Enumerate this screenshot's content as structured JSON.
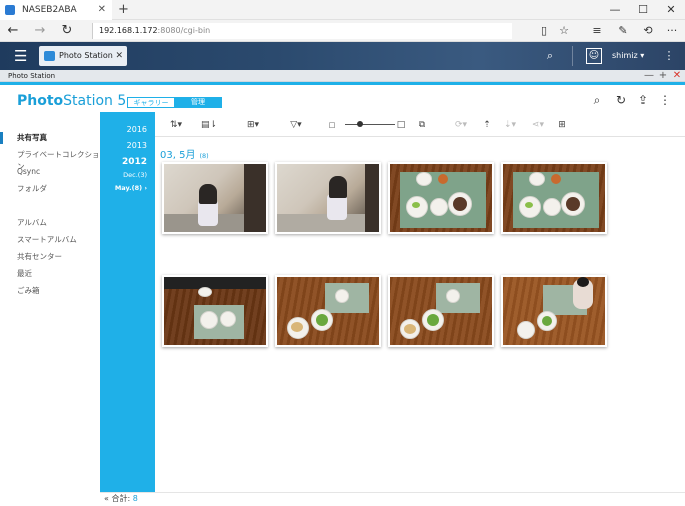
{
  "browser": {
    "tab_title": "NASEB2ABA",
    "new_tab": "+",
    "url_host": "192.168.1.172",
    "url_path": ":8080/cgi-bin",
    "window_controls": [
      "—",
      "☐",
      "✕"
    ]
  },
  "qnap": {
    "app_tab_label": "Photo Station",
    "user": "shimiz ▾"
  },
  "window": {
    "title": "Photo Station",
    "controls": [
      "—",
      "+",
      "✕"
    ]
  },
  "header": {
    "logo_bold": "Photo",
    "logo_rest": "Station 5",
    "mode_gallery": "ギャラリー",
    "mode_manage": "管理"
  },
  "sidebar": {
    "items": [
      {
        "label": "共有写真",
        "active": true
      },
      {
        "label": "プライベートコレクション"
      },
      {
        "label": "Qsync"
      },
      {
        "label": "フォルダ"
      },
      {
        "label": "アルバム"
      },
      {
        "label": "スマートアルバム"
      },
      {
        "label": "共有センター"
      },
      {
        "label": "最近"
      },
      {
        "label": "ごみ箱"
      }
    ]
  },
  "timeline": {
    "years": [
      "2016",
      "2013",
      "2012"
    ],
    "months": [
      "Dec.(3)",
      "May.(8) ›"
    ]
  },
  "content": {
    "group_title": "03, 5月",
    "group_count": "(8)"
  },
  "status": {
    "label": "合計:",
    "value": "8"
  },
  "colors": {
    "accent": "#1fb0e8",
    "brand": "#1a9fd8",
    "header_dark": "#1f3b5e"
  }
}
